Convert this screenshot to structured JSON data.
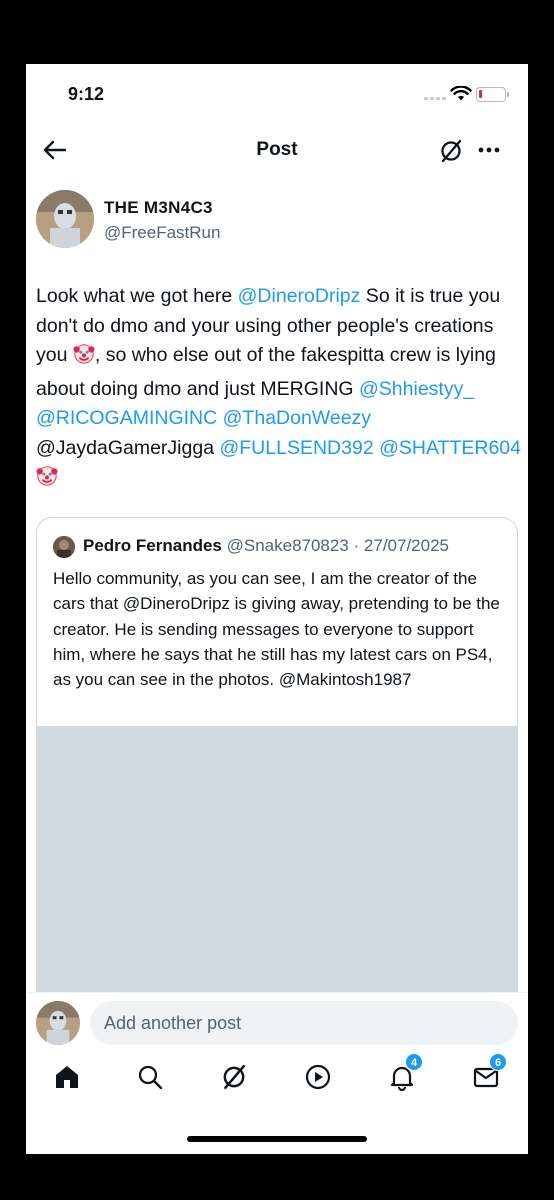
{
  "status_bar": {
    "time": "9:12"
  },
  "nav": {
    "title": "Post",
    "back_icon": "arrow-left-icon",
    "grok_icon": "grok-icon",
    "more_icon": "more-horizontal-icon"
  },
  "post": {
    "author_name": "THE M3N4C3",
    "author_handle": "@FreeFastRun",
    "body": [
      {
        "text": "Look what we got here ",
        "mention": false
      },
      {
        "text": "@DineroDripz",
        "mention": true
      },
      {
        "text": " So it is true you don't do dmo and your using other people's creations you ",
        "mention": false
      },
      {
        "emoji": "clown-face"
      },
      {
        "text": ", so who else out of the fakespitta crew is lying about doing dmo and just MERGING ",
        "mention": false
      },
      {
        "text": "@Shhiestyy_",
        "mention": true
      },
      {
        "text": " ",
        "mention": false
      },
      {
        "text": "@RICOGAMINGINC",
        "mention": true
      },
      {
        "text": " ",
        "mention": false
      },
      {
        "text": "@ThaDonWeezy",
        "mention": true
      },
      {
        "text": " @JaydaGamerJigga ",
        "mention": false
      },
      {
        "text": "@FULLSEND392",
        "mention": true
      },
      {
        "text": " ",
        "mention": false
      },
      {
        "text": "@SHATTER604",
        "mention": true
      },
      {
        "text": " ",
        "mention": false
      },
      {
        "emoji": "clown-face"
      }
    ]
  },
  "quote": {
    "name": "Pedro Fernandes",
    "handle": "@Snake870823",
    "separator": " · ",
    "date": "27/07/2025",
    "text": "Hello community, as you can see, I am the creator of the cars that @DineroDripz is giving away, pretending to be the creator. He is sending messages to everyone to support him, where he says that he still has my latest cars on PS4, as you can see in the photos. @Makintosh1987"
  },
  "reply": {
    "placeholder": "Add another post"
  },
  "tabbar": {
    "items": [
      {
        "name": "home",
        "icon": "home-icon",
        "active": true
      },
      {
        "name": "search",
        "icon": "search-icon"
      },
      {
        "name": "grok",
        "icon": "grok-icon"
      },
      {
        "name": "video",
        "icon": "play-icon"
      },
      {
        "name": "notifications",
        "icon": "bell-icon",
        "badge": "4"
      },
      {
        "name": "messages",
        "icon": "mail-icon",
        "badge": "6"
      }
    ]
  },
  "colors": {
    "accent": "#1d9bf0",
    "text": "#0f1419",
    "muted": "#536471",
    "media_placeholder": "#cfd9df"
  }
}
